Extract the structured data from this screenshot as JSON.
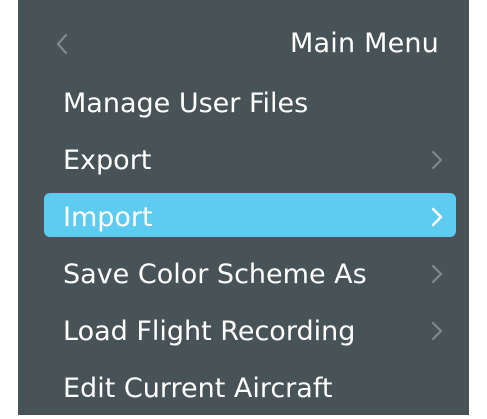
{
  "menu": {
    "title": "Main Menu",
    "back_icon": "chevron-left-icon",
    "items": [
      {
        "label": "Manage User Files",
        "has_submenu": false,
        "selected": false
      },
      {
        "label": "Export",
        "has_submenu": true,
        "selected": false
      },
      {
        "label": "Import",
        "has_submenu": true,
        "selected": true
      },
      {
        "label": "Save Color Scheme As",
        "has_submenu": true,
        "selected": false
      },
      {
        "label": "Load Flight Recording",
        "has_submenu": true,
        "selected": false
      },
      {
        "label": "Edit Current Aircraft",
        "has_submenu": false,
        "selected": false
      }
    ]
  },
  "colors": {
    "panel_background": "#475356",
    "text": "#ffffff",
    "selected_background": "#5ecbf0",
    "chevron_dim": "#7e898c",
    "chevron_selected": "#ffffff"
  }
}
